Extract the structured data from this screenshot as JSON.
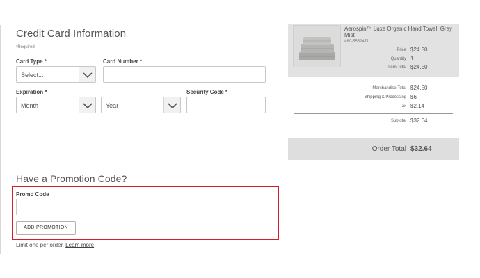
{
  "payment": {
    "title": "Credit Card Information",
    "required_note": "*Required",
    "card_type": {
      "label": "Card Type *",
      "value": "Select..."
    },
    "card_number": {
      "label": "Card Number *",
      "value": ""
    },
    "expiration": {
      "label": "Expiration *",
      "month": "Month",
      "year": "Year"
    },
    "security_code": {
      "label": "Security Code *",
      "value": ""
    }
  },
  "promotion": {
    "title": "Have a Promotion Code?",
    "promo_label": "Promo Code",
    "promo_value": "",
    "button_label": "ADD PROMOTION",
    "note": "Limit one per order.",
    "learn_more": "Learn more"
  },
  "summary": {
    "product": {
      "name": "Aerospin™ Luxe Organic Hand Towel, Gray Mist",
      "sku": "#80-5552471",
      "price_label": "Price",
      "price": "$24.50",
      "quantity_label": "Quantity",
      "quantity": "1",
      "item_total_label": "Item Total",
      "item_total": "$24.50",
      "thumbnail_icon": "towel-stack-image"
    },
    "merchandise_total_label": "Merchandise Total",
    "merchandise_total": "$24.50",
    "shipping_label": "Shipping & Processing",
    "shipping": "$6",
    "tax_label": "Tax",
    "tax": "$2.14",
    "subtotal_label": "Subtotal",
    "subtotal": "$32.64",
    "order_total_label": "Order Total",
    "order_total": "$32.64"
  },
  "colors": {
    "highlight_border": "#d11e2a",
    "panel_gray": "#e2e2e2"
  }
}
